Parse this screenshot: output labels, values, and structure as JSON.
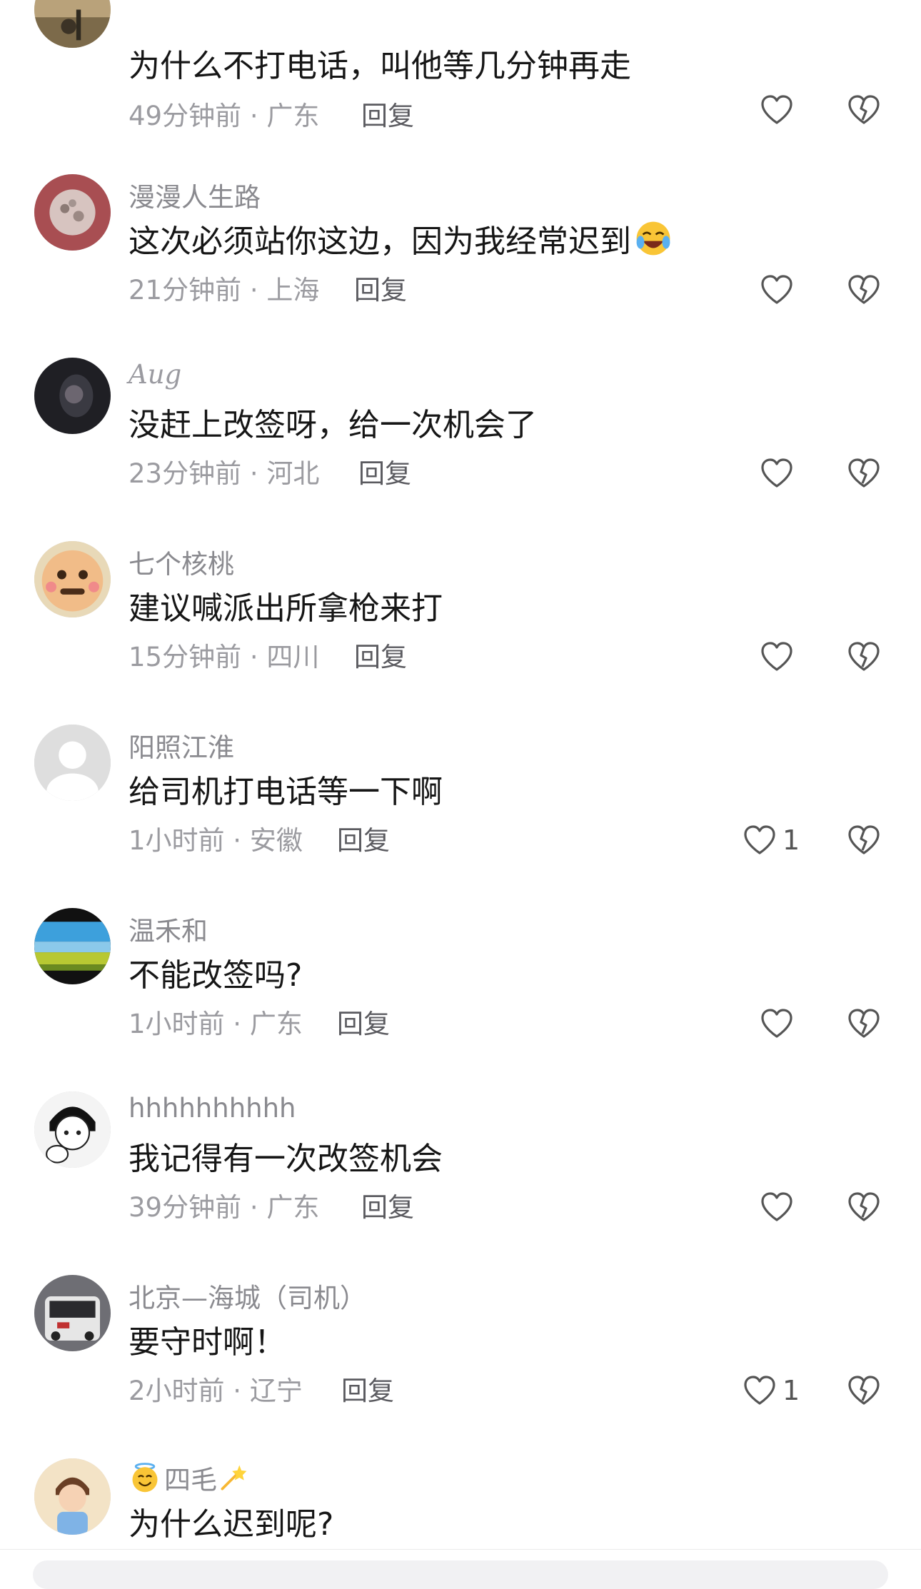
{
  "comments": [
    {
      "username": "",
      "text": "为什么不打电话，叫他等几分钟再走",
      "time": "49分钟前",
      "location": "广东",
      "reply": "回复",
      "likes": ""
    },
    {
      "username": "漫漫人生路",
      "text": "这次必须站你这边，因为我经常迟到",
      "time": "21分钟前",
      "location": "上海",
      "reply": "回复",
      "likes": ""
    },
    {
      "username": "Aug",
      "text": "没赶上改签呀，给一次机会了",
      "time": "23分钟前",
      "location": "河北",
      "reply": "回复",
      "likes": ""
    },
    {
      "username": "七个核桃",
      "text": "建议喊派出所拿枪来打",
      "time": "15分钟前",
      "location": "四川",
      "reply": "回复",
      "likes": ""
    },
    {
      "username": "阳照江淮",
      "text": "给司机打电话等一下啊",
      "time": "1小时前",
      "location": "安徽",
      "reply": "回复",
      "likes": "1"
    },
    {
      "username": "温禾和",
      "text": "不能改签吗?",
      "time": "1小时前",
      "location": "广东",
      "reply": "回复",
      "likes": ""
    },
    {
      "username": "hhhhhhhhhh",
      "text": "我记得有一次改签机会",
      "time": "39分钟前",
      "location": "广东",
      "reply": "回复",
      "likes": ""
    },
    {
      "username": "北京—海城（司机）",
      "text": "要守时啊！",
      "time": "2小时前",
      "location": "辽宁",
      "reply": "回复",
      "likes": "1"
    },
    {
      "username": "四毛",
      "text": "为什么迟到呢?",
      "time": "",
      "location": "",
      "reply": "",
      "likes": ""
    }
  ],
  "separator": " · ",
  "icons": {
    "like": "heart-outline-icon",
    "dislike": "broken-heart-icon"
  },
  "colors": {
    "meta": "#9b9ba0",
    "username": "#8a8a8f",
    "text": "#161616"
  }
}
